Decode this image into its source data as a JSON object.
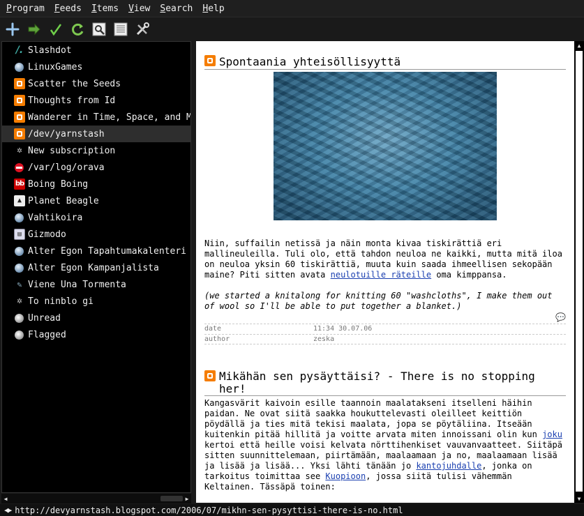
{
  "menu": [
    {
      "acc": "P",
      "rest": "rogram"
    },
    {
      "acc": "F",
      "rest": "eeds"
    },
    {
      "acc": "I",
      "rest": "tems"
    },
    {
      "acc": "V",
      "rest": "iew"
    },
    {
      "acc": "S",
      "rest": "earch"
    },
    {
      "acc": "H",
      "rest": "elp"
    }
  ],
  "toolbar": {
    "icons": [
      "add-icon",
      "forward-arrow-icon",
      "check-icon",
      "refresh-icon",
      "search-icon",
      "list-icon",
      "tools-icon"
    ]
  },
  "feeds": [
    {
      "label": "Slashdot",
      "icon": "slashdot-icon"
    },
    {
      "label": "LinuxGames",
      "icon": "globe-icon"
    },
    {
      "label": "Scatter the Seeds",
      "icon": "blogger-icon"
    },
    {
      "label": "Thoughts from Id",
      "icon": "blogger-icon"
    },
    {
      "label": "Wanderer in Time, Space, and M",
      "icon": "blogger-icon"
    },
    {
      "label": "/dev/yarnstash",
      "icon": "blogger-icon",
      "selected": true
    },
    {
      "label": "New subscription",
      "icon": "satellite-icon"
    },
    {
      "label": "/var/log/orava",
      "icon": "error-icon"
    },
    {
      "label": "Boing Boing",
      "icon": "boingboing-icon",
      "bb": "bb"
    },
    {
      "label": "Planet Beagle",
      "icon": "tux-icon"
    },
    {
      "label": "Vahtikoira",
      "icon": "globe-icon"
    },
    {
      "label": "Gizmodo",
      "icon": "gizmodo-icon"
    },
    {
      "label": "Alter Egon Tapahtumakalenteri",
      "icon": "globe-icon"
    },
    {
      "label": "Alter Egon Kampanjalista",
      "icon": "globe-icon"
    },
    {
      "label": "Viene Una Tormenta",
      "icon": "pen-icon"
    },
    {
      "label": "To ninblo gi",
      "icon": "satellite-icon"
    },
    {
      "label": "Unread",
      "icon": "search-folder-icon"
    },
    {
      "label": "Flagged",
      "icon": "search-folder-icon"
    }
  ],
  "article1": {
    "title": "Spontaania yhteisöllisyyttä",
    "p1_before": "Niin, suffailin netissä ja näin monta kivaa tiskirättiä eri mallineuleilla. Tuli olo, että tahdon neuloa ne kaikki, mutta mitä iloa on neuloa yksin 60 tiskirättiä, muuta kuin saada ihmeellisen sekopään maine? Piti sitten avata ",
    "p1_link": "neulotuille räteille",
    "p1_after": " oma kimppansa.",
    "note": "(we started a knitalong for knitting 60 \"washcloths\", I make them out of wool so I'll be able to put together a blanket.)",
    "meta": [
      {
        "key": "date",
        "value": "11:34 30.07.06"
      },
      {
        "key": "author",
        "value": "zeska"
      }
    ]
  },
  "article2": {
    "title": "Mikähän sen pysäyttäisi? - There is no stopping her!",
    "t1": "Kangasvärit kaivoin esille taannoin maalatakseni itselleni häihin paidan. Ne ovat siitä saakka houkuttelevasti oleilleet keittiön pöydällä ja ties mitä tekisi maalata, jopa se pöytäliina. Itseään kuitenkin pitää hillitä ja voitte arvata miten innoissani olin kun ",
    "l1": "joku",
    "t2": " kertoi että heille voisi kelvata nörttihenkiset vauvanvaatteet. Siitäpä sitten suunnittelemaan, piirtämään, maalaamaan ja no, maalaamaan lisää ja lisää ja lisää... Yksi lähti tänään jo ",
    "l2": "kantojuhdalle",
    "t3": ", jonka on tarkoitus toimittaa see ",
    "l3": "Kuopioon",
    "t4": ", jossa siitä tulisi vähemmän Keltainen. Tässäpä toinen:"
  },
  "status": {
    "url": "http://devyarnstash.blogspot.com/2006/07/mikhn-sen-pysyttisi-there-is-no.html"
  }
}
